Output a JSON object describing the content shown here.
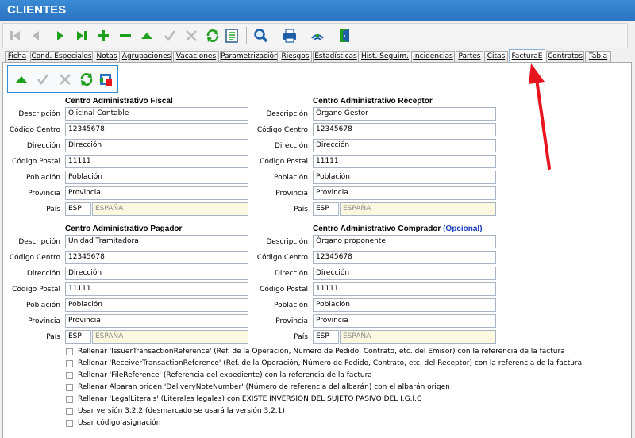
{
  "window": {
    "title": "CLIENTES"
  },
  "toolbar": {
    "buttons": [
      "first-icon",
      "prev-icon",
      "next-icon",
      "last-icon",
      "add-icon",
      "remove-icon",
      "save-icon",
      "confirm-icon",
      "cancel-icon",
      "refresh-icon",
      "notes-icon",
      "search-icon",
      "print-icon",
      "signal-icon",
      "exit-door-icon"
    ]
  },
  "tabs": [
    "Ficha",
    "Cond. Especiales",
    "Notas",
    "Agrupaciones",
    "Vacaciones",
    "Parametrización",
    "Riesgos",
    "Estadísticas",
    "Hist. Seguim.",
    "Incidencias",
    "Partes",
    "Citas",
    "FacturaE",
    "Contratos",
    "Tabla"
  ],
  "active_tab": "FacturaE",
  "labels": {
    "descripcion": "Descripción",
    "codigo_centro": "Código Centro",
    "direccion": "Dirección",
    "codigo_postal": "Código Postal",
    "poblacion": "Población",
    "provincia": "Provincia",
    "pais": "País"
  },
  "sections": {
    "fiscal": {
      "title": "Centro Administrativo Fiscal",
      "descripcion": "Olicinal Contable",
      "codigo_centro": "12345678",
      "direccion": "Dirección",
      "codigo_postal": "11111",
      "poblacion": "Población",
      "provincia": "Provincia",
      "pais_code": "ESP",
      "pais_name": "ESPAÑA"
    },
    "receptor": {
      "title": "Centro Administrativo Receptor",
      "descripcion": "Órgano Gestor",
      "codigo_centro": "12345678",
      "direccion": "Dirección",
      "codigo_postal": "11111",
      "poblacion": "Población",
      "provincia": "Provincia",
      "pais_code": "ESP",
      "pais_name": "ESPAÑA"
    },
    "pagador": {
      "title": "Centro Administrativo Pagador",
      "descripcion": "Unidad Tramitadora",
      "codigo_centro": "12345678",
      "direccion": "Dirección",
      "codigo_postal": "11111",
      "poblacion": "Población",
      "provincia": "Provincia",
      "pais_code": "ESP",
      "pais_name": "ESPAÑA"
    },
    "comprador": {
      "title": "Centro Administrativo Comprador",
      "optional": "(Opcional)",
      "descripcion": "Órgano proponente",
      "codigo_centro": "12345678",
      "direccion": "Dirección",
      "codigo_postal": "11111",
      "poblacion": "Población",
      "provincia": "Provincia",
      "pais_code": "ESP",
      "pais_name": "ESPAÑA"
    }
  },
  "checkboxes": [
    {
      "label": "Rellenar 'IssuerTransactionReference' (Ref. de la Operación, Número de Pedido, Contrato, etc. del Emisor) con la referencia de la factura",
      "checked": false
    },
    {
      "label": "Rellenar 'ReceiverTransactionReference' (Ref. de la Operación, Número de Pedido, Contrato, etc. del Receptor) con la referencia de la factura",
      "checked": false
    },
    {
      "label": "Rellenar 'FileReference' (Referencia del expediente) con la referencia de la factura",
      "checked": false
    },
    {
      "label": "Rellenar Albaran origen 'DeliveryNoteNumber' (Número de referencia del albarán) con el albarán origen",
      "checked": false
    },
    {
      "label": "Rellenar 'LegalLiterals' (Literales legales) con EXISTE INVERSION DEL SUJETO PASIVO DEL I.G.I.C",
      "checked": false
    },
    {
      "label": "Usar versión 3.2.2 (desmarcado se usará la versión 3.2.1)",
      "checked": false
    },
    {
      "label": "Usar código asignación",
      "checked": false
    }
  ],
  "colors": {
    "title_bar": "#2b74c0",
    "accent_green": "#1ea01e",
    "annotation_arrow": "#e8141e"
  }
}
